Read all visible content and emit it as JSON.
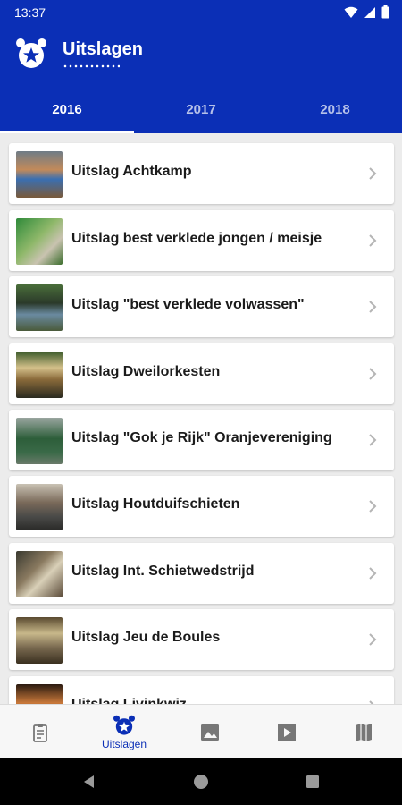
{
  "status_bar": {
    "time": "13:37"
  },
  "app_bar": {
    "title": "Uitslagen"
  },
  "tabs": [
    {
      "label": "2016",
      "active": true
    },
    {
      "label": "2017",
      "active": false
    },
    {
      "label": "2018",
      "active": false
    }
  ],
  "results": [
    {
      "label": "Uitslag Achtkamp"
    },
    {
      "label": "Uitslag best verklede jongen / meisje"
    },
    {
      "label": "Uitslag \"best verklede volwassen\""
    },
    {
      "label": "Uitslag Dweilorkesten"
    },
    {
      "label": "Uitslag \"Gok je Rijk\" Oranjevereniging"
    },
    {
      "label": "Uitslag Houtduifschieten"
    },
    {
      "label": "Uitslag Int. Schietwedstrijd"
    },
    {
      "label": "Uitslag Jeu de Boules"
    },
    {
      "label": "Uitslag Livinkwiz"
    }
  ],
  "bottom_nav": [
    {
      "icon": "clipboard-icon",
      "label": ""
    },
    {
      "icon": "orange-club-logo-icon",
      "label": "Uitslagen",
      "active": true
    },
    {
      "icon": "image-icon",
      "label": ""
    },
    {
      "icon": "play-icon",
      "label": ""
    },
    {
      "icon": "map-icon",
      "label": ""
    }
  ],
  "colors": {
    "primary": "#0b2fb6",
    "background": "#ececec",
    "card": "#ffffff"
  }
}
